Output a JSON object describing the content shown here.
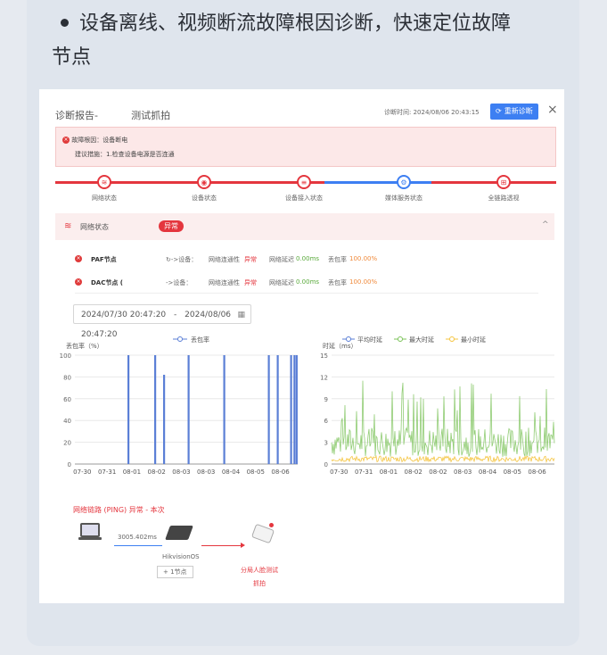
{
  "headline": {
    "line1": "设备离线、视频断流故障根因诊断，快速定位故障",
    "line2": "节点"
  },
  "report": {
    "title": "诊断报告-",
    "title_suffix": "测试抓拍",
    "diag_time_label": "诊断时间:",
    "diag_time": "2024/08/06 20:43:15",
    "rediagnose_label": "重新诊断",
    "close_label": "×"
  },
  "alert": {
    "root_cause": "故障根因：设备断电",
    "suggestion": "建议措施：1.检查设备电源是否连通"
  },
  "steps": [
    {
      "label": "网络状态",
      "icon": "wifi-icon"
    },
    {
      "label": "设备状态",
      "icon": "device-icon"
    },
    {
      "label": "设备接入状态",
      "icon": "access-icon"
    },
    {
      "label": "媒体服务状态",
      "icon": "gear-icon"
    },
    {
      "label": "全链路透视",
      "icon": "link-icon"
    }
  ],
  "network": {
    "label": "网络状态",
    "badge": "异常",
    "chevron": "^"
  },
  "nodes": [
    {
      "name": "PAF节点",
      "arrow": "↻->设备：",
      "conn_label": "网络连通性",
      "conn": "异常",
      "latency_label": "网络延迟",
      "latency": "0.00ms",
      "loss_label": "丢包率",
      "loss": "100.00%"
    },
    {
      "name": "DAC节点 (",
      "arrow": "->设备：",
      "conn_label": "网络连通性",
      "conn": "异常",
      "latency_label": "网络延迟",
      "latency": "0.00ms",
      "loss_label": "丢包率",
      "loss": "100.00%"
    }
  ],
  "daterange": {
    "start": "2024/07/30 20:47:20",
    "sep": "-",
    "end": "2024/08/06 20:47:20"
  },
  "colors": {
    "accent": "#3d7ff2",
    "error": "#e4363e",
    "green": "#7cc35a",
    "yellow": "#f5c542",
    "loss_line": "#5b7fd6"
  },
  "chart_data": [
    {
      "type": "line",
      "ylabel": "丢包率（%）",
      "legend": [
        "丢包率"
      ],
      "ylim": [
        0,
        100
      ],
      "yticks": [
        0,
        20,
        40,
        60,
        80,
        100
      ],
      "xticks": [
        "07-30",
        "07-31",
        "08-01",
        "08-02",
        "08-03",
        "08-03",
        "08-04",
        "08-05",
        "08-06"
      ],
      "series": [
        {
          "name": "丢包率",
          "spikes": [
            {
              "x": 0.24,
              "y": 100
            },
            {
              "x": 0.36,
              "y": 100
            },
            {
              "x": 0.4,
              "y": 82
            },
            {
              "x": 0.51,
              "y": 100
            },
            {
              "x": 0.67,
              "y": 100
            },
            {
              "x": 0.87,
              "y": 100
            },
            {
              "x": 0.91,
              "y": 100
            },
            {
              "x": 0.97,
              "y": 100
            },
            {
              "x": 0.985,
              "y": 100
            },
            {
              "x": 0.995,
              "y": 100
            }
          ]
        }
      ]
    },
    {
      "type": "line",
      "ylabel": "时延（ms）",
      "legend": [
        "平均时延",
        "最大时延",
        "最小时延"
      ],
      "ylim": [
        0,
        15
      ],
      "yticks": [
        0,
        3,
        6,
        9,
        12,
        15
      ],
      "xticks": [
        "07-30",
        "07-31",
        "08-01",
        "08-02",
        "08-02",
        "08-03",
        "08-04",
        "08-05",
        "08-06"
      ]
    }
  ],
  "ping": {
    "title": "网络链路 (PING) 异常 - 本次",
    "latency": "3005.402ms",
    "device_name": "HikvisionOS",
    "badge": "+ 1节点",
    "target_line1": "分局人脸测试",
    "target_line2": "抓拍"
  }
}
